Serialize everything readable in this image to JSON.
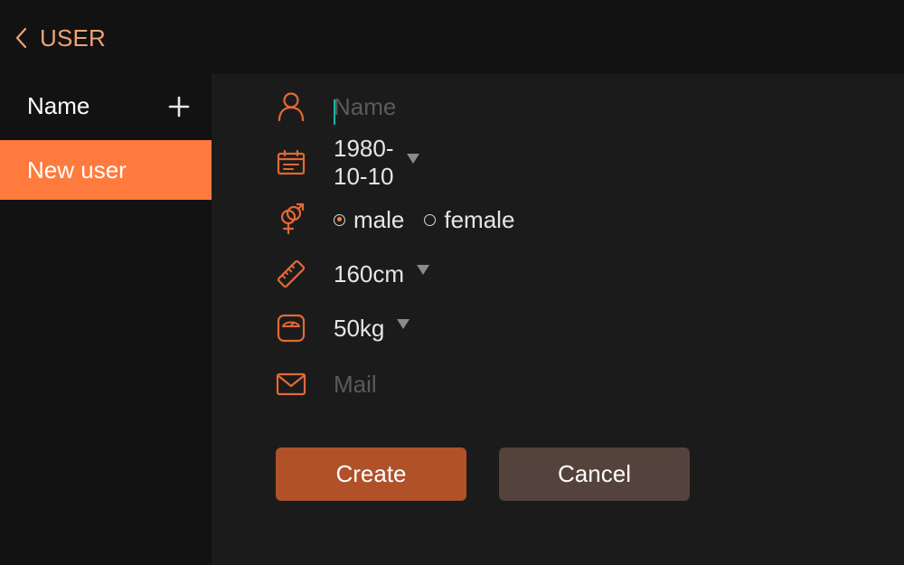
{
  "header": {
    "back_label": "USER",
    "accent_color": "#f0a275"
  },
  "sidebar": {
    "title": "Name",
    "add_icon": "plus-icon",
    "items": [
      {
        "label": "New user",
        "selected": true
      }
    ],
    "selected_color": "#ff7a3d"
  },
  "form": {
    "name": {
      "icon": "person-icon",
      "value": "",
      "placeholder": "Name"
    },
    "birthday": {
      "icon": "calendar-icon",
      "value": "1980-10-10"
    },
    "gender": {
      "icon": "gender-icon",
      "options": [
        {
          "label": "male",
          "checked": true
        },
        {
          "label": "female",
          "checked": false
        }
      ]
    },
    "height": {
      "icon": "ruler-icon",
      "value": "160cm"
    },
    "weight": {
      "icon": "scale-icon",
      "value": "50kg"
    },
    "mail": {
      "icon": "mail-icon",
      "value": "",
      "placeholder": "Mail"
    }
  },
  "actions": {
    "create_label": "Create",
    "cancel_label": "Cancel",
    "create_color": "#b0512a",
    "cancel_color": "#54433c"
  }
}
